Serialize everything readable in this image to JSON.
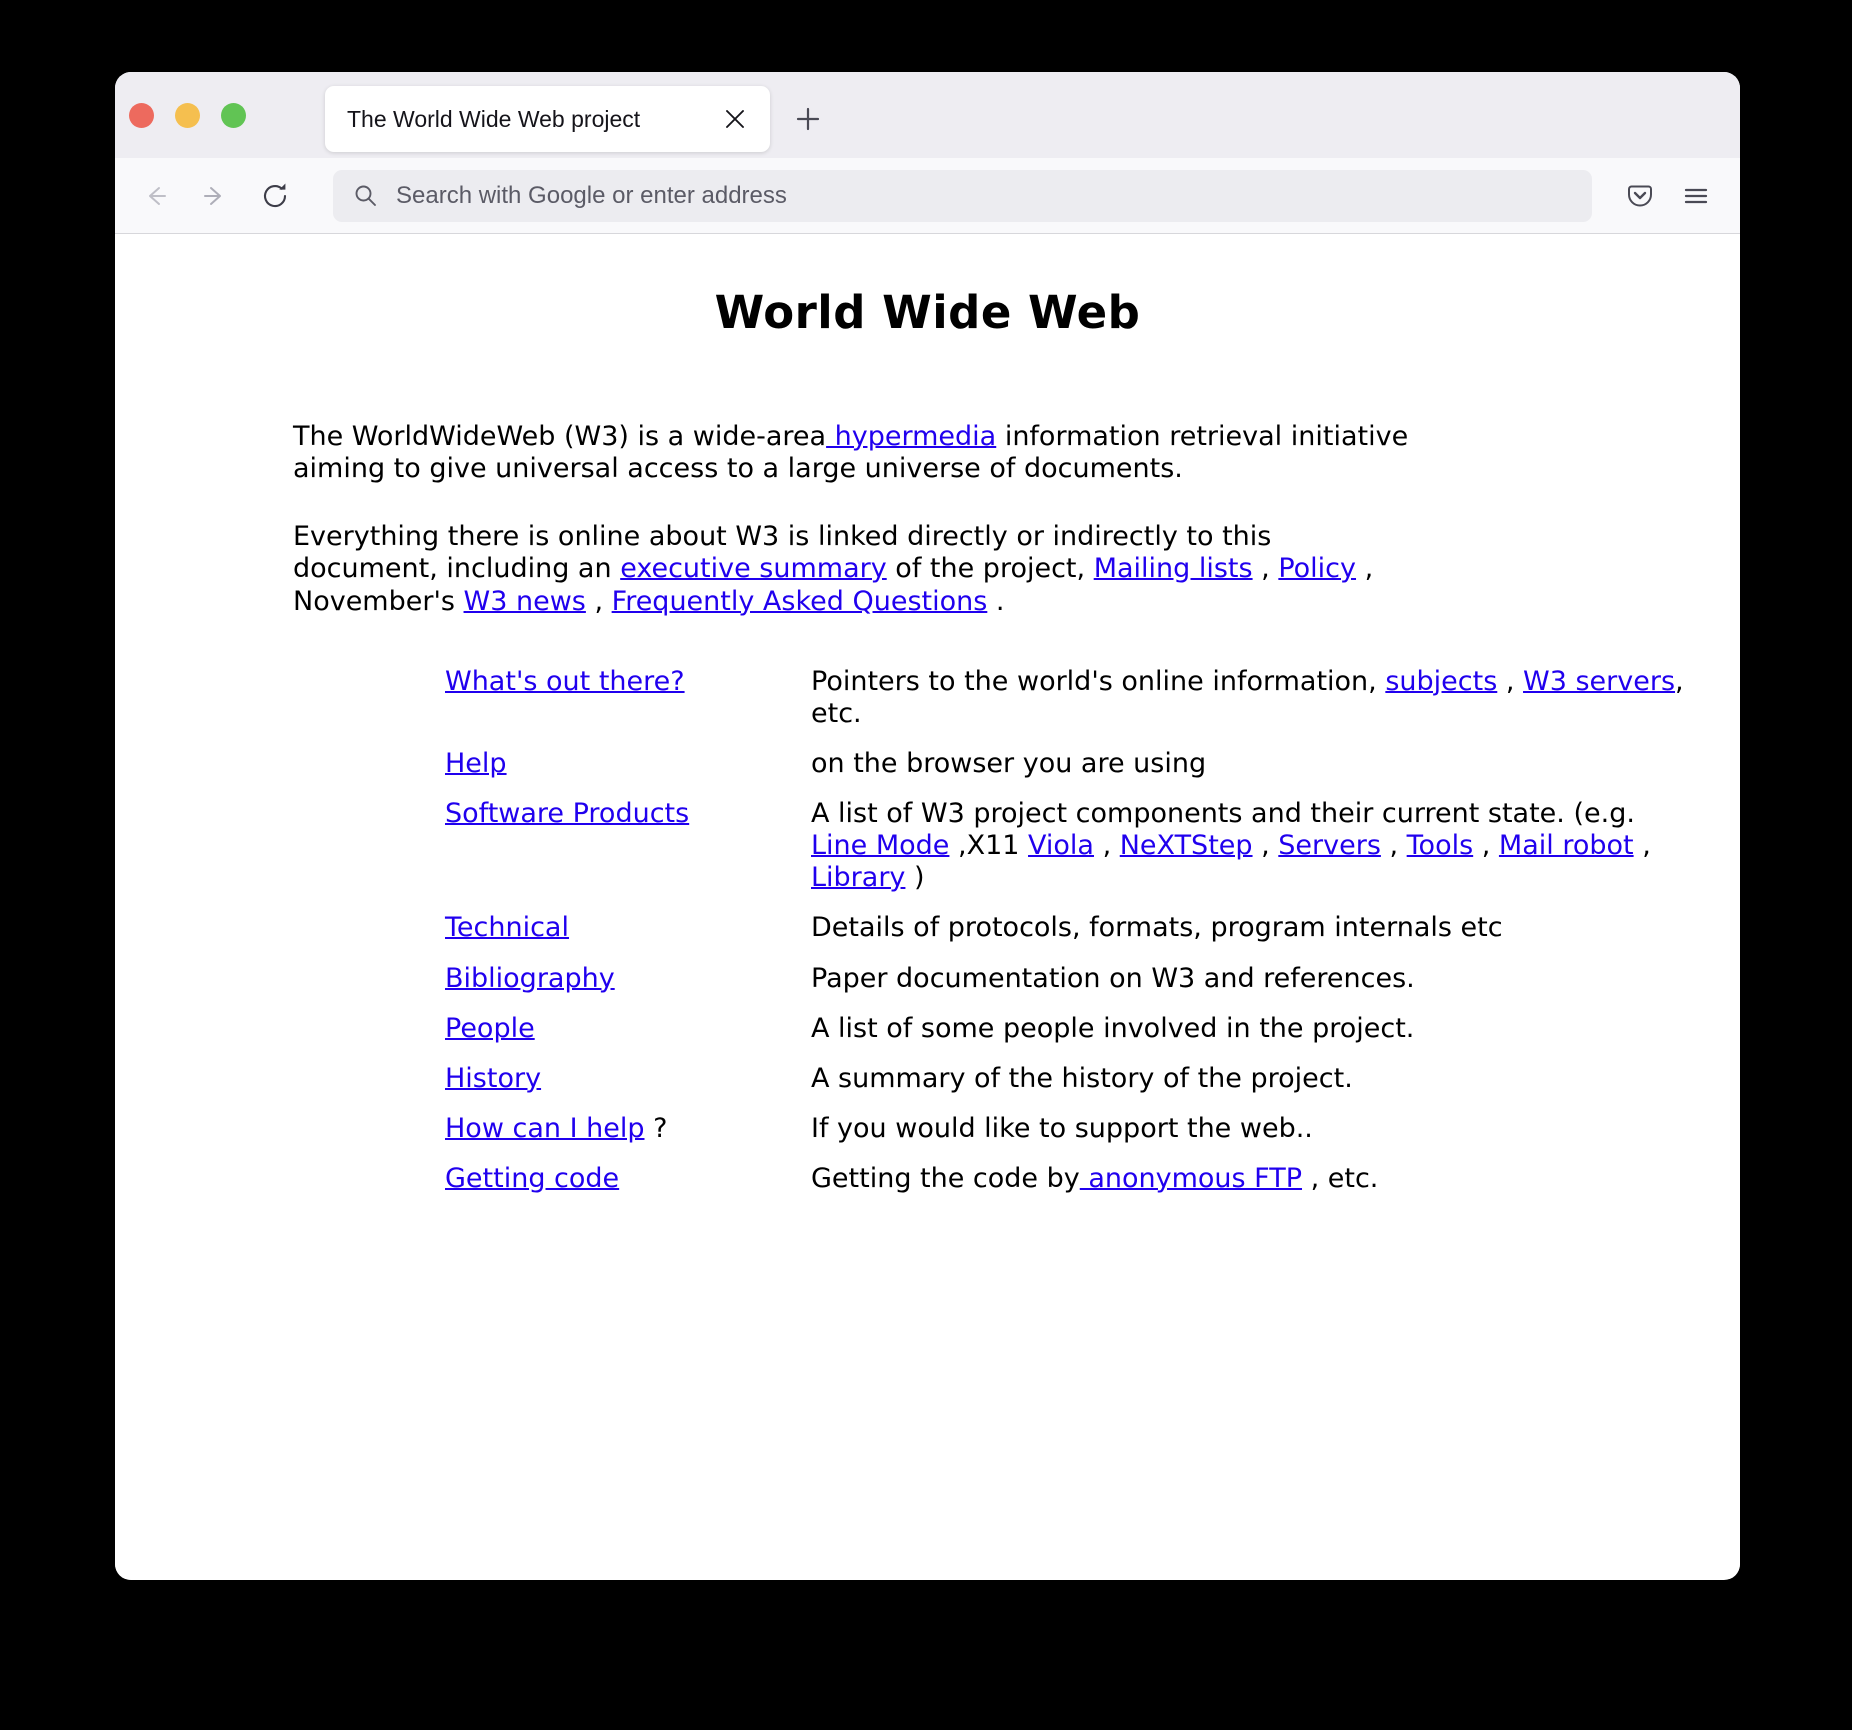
{
  "window": {
    "traffic_lights": [
      "close",
      "minimize",
      "maximize"
    ],
    "colors": {
      "close": "#ed6a5e",
      "minimize": "#f5bf4f",
      "maximize": "#61c454",
      "link": "#2000ee"
    }
  },
  "tabbar": {
    "tab_title": "The World Wide Web project",
    "close_tab_label": "×",
    "new_tab_label": "+"
  },
  "toolbar": {
    "back_label": "Back",
    "forward_label": "Forward",
    "reload_label": "Reload",
    "pocket_label": "Save to Pocket",
    "menu_label": "Open application menu",
    "address_placeholder": "Search with Google or enter address",
    "address_value": ""
  },
  "page": {
    "heading": "World Wide Web",
    "p1": {
      "before": "The WorldWideWeb (W3) is a wide-area",
      "link": " hypermedia",
      "after": " information retrieval initiative aiming to give universal access to a large universe of documents."
    },
    "p2": {
      "t1": "Everything there is online about W3 is linked directly or indirectly to this document, including an ",
      "l1": "executive summary",
      "t2": " of the project, ",
      "l2": "Mailing lists",
      "t3": " , ",
      "l3": "Policy",
      "t4": " , November's ",
      "l4": "W3 news",
      "t5": " , ",
      "l5": "Frequently Asked Questions",
      "t6": " ."
    },
    "entries": [
      {
        "term": "What's out there?",
        "term_suffix": "",
        "desc_parts": [
          {
            "type": "text",
            "text": "Pointers to the world's online information, "
          },
          {
            "type": "link",
            "text": "subjects"
          },
          {
            "type": "text",
            "text": " , "
          },
          {
            "type": "link",
            "text": "W3 servers"
          },
          {
            "type": "text",
            "text": ", etc."
          }
        ]
      },
      {
        "term": "Help",
        "term_suffix": "",
        "desc_parts": [
          {
            "type": "text",
            "text": "on the browser you are using"
          }
        ]
      },
      {
        "term": "Software Products",
        "term_suffix": "",
        "desc_parts": [
          {
            "type": "text",
            "text": "A list of W3 project components and their current state. (e.g. "
          },
          {
            "type": "link",
            "text": "Line Mode"
          },
          {
            "type": "text",
            "text": " ,X11 "
          },
          {
            "type": "link",
            "text": "Viola"
          },
          {
            "type": "text",
            "text": " , "
          },
          {
            "type": "link",
            "text": "NeXTStep"
          },
          {
            "type": "text",
            "text": " , "
          },
          {
            "type": "link",
            "text": "Servers"
          },
          {
            "type": "text",
            "text": " , "
          },
          {
            "type": "link",
            "text": "Tools"
          },
          {
            "type": "text",
            "text": " , "
          },
          {
            "type": "link",
            "text": "Mail robot"
          },
          {
            "type": "text",
            "text": " , "
          },
          {
            "type": "link",
            "text": "Library"
          },
          {
            "type": "text",
            "text": " )"
          }
        ]
      },
      {
        "term": "Technical",
        "term_suffix": "",
        "desc_parts": [
          {
            "type": "text",
            "text": "Details of protocols, formats, program internals etc"
          }
        ]
      },
      {
        "term": "Bibliography",
        "term_suffix": "",
        "desc_parts": [
          {
            "type": "text",
            "text": "Paper documentation on W3 and references."
          }
        ]
      },
      {
        "term": "People",
        "term_suffix": "",
        "desc_parts": [
          {
            "type": "text",
            "text": "A list of some people involved in the project."
          }
        ]
      },
      {
        "term": "History",
        "term_suffix": "",
        "desc_parts": [
          {
            "type": "text",
            "text": "A summary of the history of the project."
          }
        ]
      },
      {
        "term": "How can I help",
        "term_suffix": " ?",
        "desc_parts": [
          {
            "type": "text",
            "text": "If you would like to support the web.."
          }
        ]
      },
      {
        "term": "Getting code",
        "term_suffix": "",
        "desc_parts": [
          {
            "type": "text",
            "text": "Getting the code by"
          },
          {
            "type": "link",
            "text": " anonymous FTP"
          },
          {
            "type": "text",
            "text": " , etc."
          }
        ]
      }
    ]
  }
}
